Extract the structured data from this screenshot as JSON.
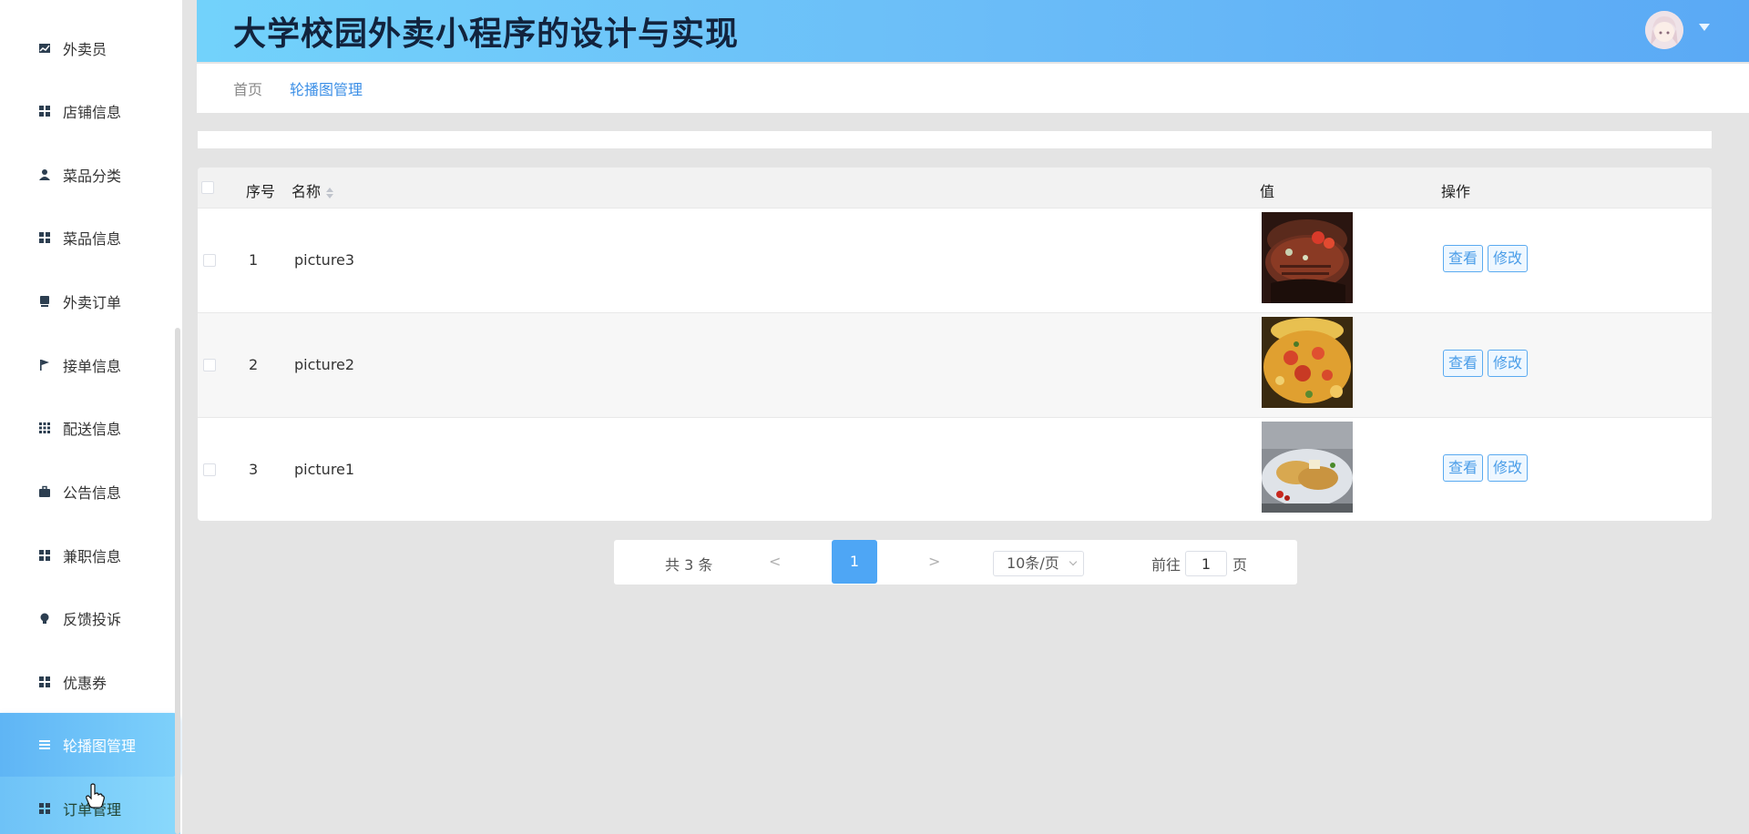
{
  "header": {
    "title": "大学校园外卖小程序的设计与实现"
  },
  "sidebar": {
    "items": [
      {
        "label": "外卖员",
        "icon": "chart-icon"
      },
      {
        "label": "店铺信息",
        "icon": "grid-icon"
      },
      {
        "label": "菜品分类",
        "icon": "user-icon"
      },
      {
        "label": "菜品信息",
        "icon": "grid-icon"
      },
      {
        "label": "外卖订单",
        "icon": "print-icon"
      },
      {
        "label": "接单信息",
        "icon": "flag-icon"
      },
      {
        "label": "配送信息",
        "icon": "grid-9-icon"
      },
      {
        "label": "公告信息",
        "icon": "briefcase-icon"
      },
      {
        "label": "兼职信息",
        "icon": "grid-icon"
      },
      {
        "label": "反馈投诉",
        "icon": "bulb-icon"
      },
      {
        "label": "优惠券",
        "icon": "grid-icon"
      },
      {
        "label": "轮播图管理",
        "icon": "list-icon"
      },
      {
        "label": "订单管理",
        "icon": "grid-icon"
      }
    ],
    "active_index": 11
  },
  "breadcrumb": {
    "home": "首页",
    "current": "轮播图管理"
  },
  "table": {
    "columns": {
      "index": "序号",
      "name": "名称",
      "value": "值",
      "actions": "操作"
    },
    "rows": [
      {
        "index": "1",
        "name": "picture3",
        "thumb": "steak"
      },
      {
        "index": "2",
        "name": "picture2",
        "thumb": "pizza"
      },
      {
        "index": "3",
        "name": "picture1",
        "thumb": "dumplings"
      }
    ],
    "view_label": "查看",
    "edit_label": "修改"
  },
  "pagination": {
    "total": "共 3 条",
    "prev": "<",
    "next": ">",
    "current_page": "1",
    "page_size": "10条/页",
    "goto_label": "前往",
    "goto_value": "1",
    "goto_suffix": "页"
  },
  "colors": {
    "accent": "#4ea6f5",
    "header_start": "#72d2fb",
    "header_end": "#5aa9f5"
  }
}
